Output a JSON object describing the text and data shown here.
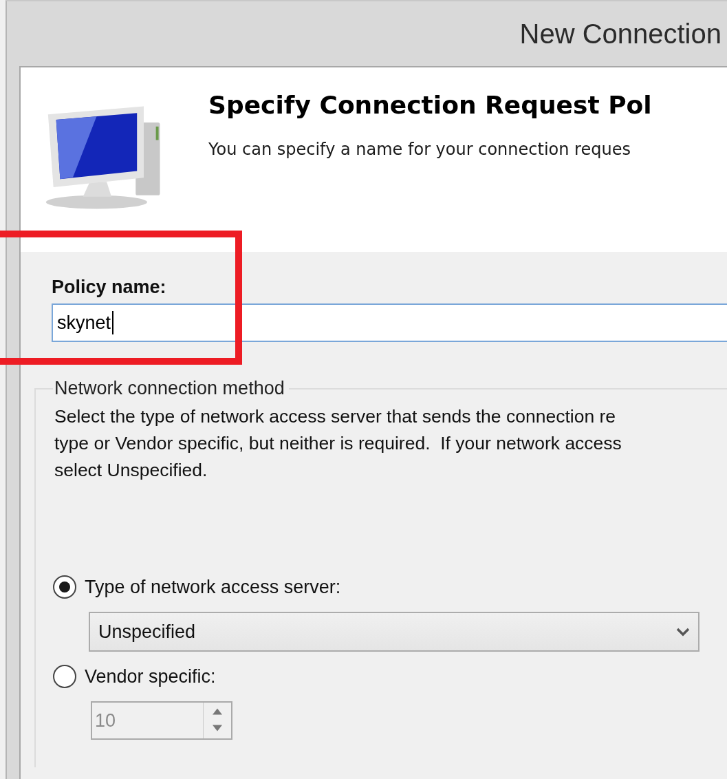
{
  "window": {
    "title": "New Connection"
  },
  "header": {
    "title": "Specify Connection Request Pol",
    "subtitle": "You can specify a name for your connection reques"
  },
  "policy_name": {
    "label": "Policy name:",
    "value": "skynet",
    "focused": true,
    "highlighted": true
  },
  "method_group": {
    "legend": "Network connection method",
    "description_lines": [
      "Select the type of network access server that sends the connection re",
      "type or Vendor specific, but neither is required.  If your network access",
      "select Unspecified."
    ],
    "options": [
      {
        "kind": "dropdown",
        "label": "Type of network access server:",
        "selected": true,
        "disabled": false,
        "value": "Unspecified"
      },
      {
        "kind": "spinner",
        "label": "Vendor specific:",
        "selected": false,
        "disabled": true,
        "value": "10"
      }
    ]
  }
}
